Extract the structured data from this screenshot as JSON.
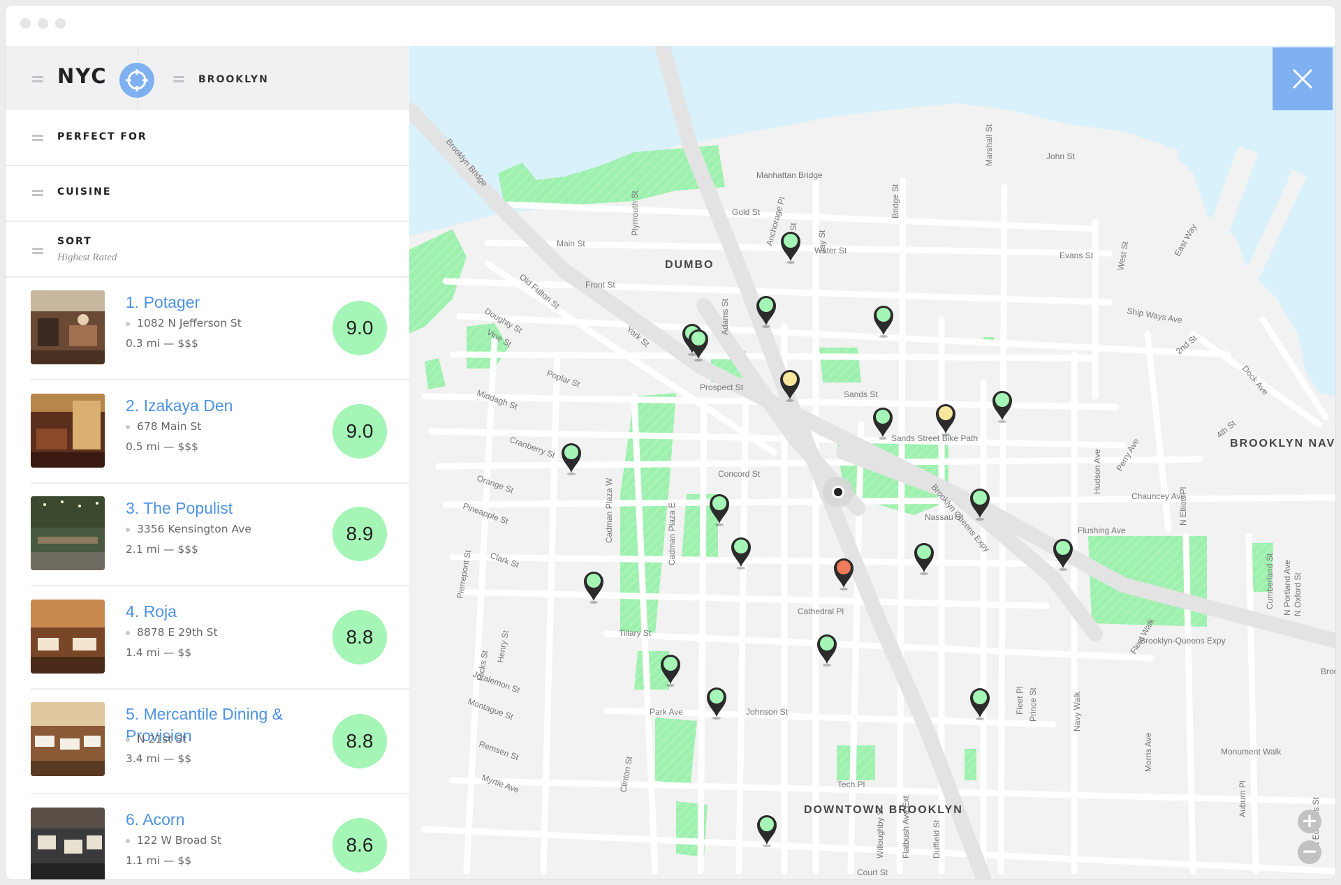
{
  "header": {
    "city": "NYC",
    "borough": "BROOKLYN"
  },
  "filters": {
    "perfect_for": "PERFECT FOR",
    "cuisine": "CUISINE",
    "sort_label": "SORT",
    "sort_value": "Highest Rated"
  },
  "restaurants": [
    {
      "name": "1. Potager",
      "address": "1082 N Jefferson St",
      "meta": "0.3 mi — $$$",
      "score": "9.0"
    },
    {
      "name": "2. Izakaya Den",
      "address": "678 Main St",
      "meta": "0.5 mi — $$$",
      "score": "9.0"
    },
    {
      "name": "3. The Populist",
      "address": "3356 Kensington Ave",
      "meta": "2.1 mi — $$$",
      "score": "8.9"
    },
    {
      "name": "4. Roja",
      "address": "8878 E 29th St",
      "meta": "1.4 mi — $$",
      "score": "8.8"
    },
    {
      "name": "5. Mercantile Dining & Provision",
      "address": "N 21st St",
      "meta": "3.4 mi — $$",
      "score": "8.8"
    },
    {
      "name": "6. Acorn",
      "address": "122 W Broad St",
      "meta": "1.1 mi — $$",
      "score": "8.6"
    }
  ],
  "map": {
    "areas": {
      "dumbo": "DUMBO",
      "downtown": "DOWNTOWN BROOKLYN",
      "navy": "BROOKLYN NAVY"
    },
    "streets": [
      "Brooklyn Bridge",
      "Manhattan Bridge",
      "John St",
      "Marshall St",
      "Gold St",
      "Plymouth St",
      "Main St",
      "Water St",
      "Anchorage Pl",
      "Pearl St",
      "Jay St",
      "Bridge St",
      "Evans St",
      "West St",
      "East Way",
      "Old Fulton St",
      "Front St",
      "Doughty St",
      "Vine St",
      "York St",
      "Adams St",
      "Ship Ways Ave",
      "2nd St",
      "Dock Ave",
      "Poplar St",
      "Middagh St",
      "Prospect St",
      "Sands St",
      "Sands Street Bike Path",
      "Cranberry St",
      "Orange St",
      "Pineapple St",
      "Clark St",
      "Cadman Plaza W",
      "Cadman Plaza E",
      "Brooklyn Queens Expy",
      "Nassau St",
      "Flushing Ave",
      "Concord St",
      "Cathedral Pl",
      "Tillary St",
      "Brooklyn-Queens Expy",
      "Park Ave",
      "Johnson St",
      "Tech Pl",
      "Myrtle Ave",
      "Remsen St",
      "Montague St",
      "Joralemon St",
      "Pierrepont St",
      "Hicks St",
      "Henry St",
      "Clinton St",
      "Court St",
      "Willoughby St",
      "Flatbush Ave Ext",
      "Duffield St",
      "Fleet Pl",
      "Navy Walk",
      "Monument Walk",
      "Auburn Pl",
      "St Edwards St",
      "N Portland Ave",
      "N Oxford St",
      "N Elliott Pl",
      "Hudson Ave",
      "Perry Ave",
      "Chauncey Ave",
      "4th St",
      "Morris Ave",
      "Cumberland St",
      "Brooklyn-Queens Expy",
      "Fleet Walk",
      "Prince St"
    ],
    "pins": [
      {
        "color": "#a4f5b6"
      },
      {
        "color": "#a4f5b6"
      },
      {
        "color": "#a4f5b6"
      },
      {
        "color": "#a4f5b6"
      },
      {
        "color": "#f9e79f"
      },
      {
        "color": "#a4f5b6"
      },
      {
        "color": "#f9e79f"
      },
      {
        "color": "#a4f5b6"
      },
      {
        "color": "#a4f5b6"
      },
      {
        "color": "#a4f5b6"
      },
      {
        "color": "#a4f5b6"
      },
      {
        "color": "#a4f5b6"
      },
      {
        "color": "#a4f5b6"
      },
      {
        "color": "#a4f5b6"
      },
      {
        "color": "#f07a5a"
      },
      {
        "color": "#a4f5b6"
      },
      {
        "color": "#a4f5b6"
      },
      {
        "color": "#a4f5b6"
      },
      {
        "color": "#a4f5b6"
      },
      {
        "color": "#a4f5b6"
      },
      {
        "color": "#a4f5b6"
      },
      {
        "color": "#a4f5b6"
      }
    ],
    "zoom_in": "+",
    "zoom_out": "−"
  },
  "colors": {
    "accent": "#7fb1f2",
    "score_green": "#a4f5b6",
    "water": "#d9f1fb",
    "park": "#9ef0ae",
    "link": "#4e92e0"
  }
}
